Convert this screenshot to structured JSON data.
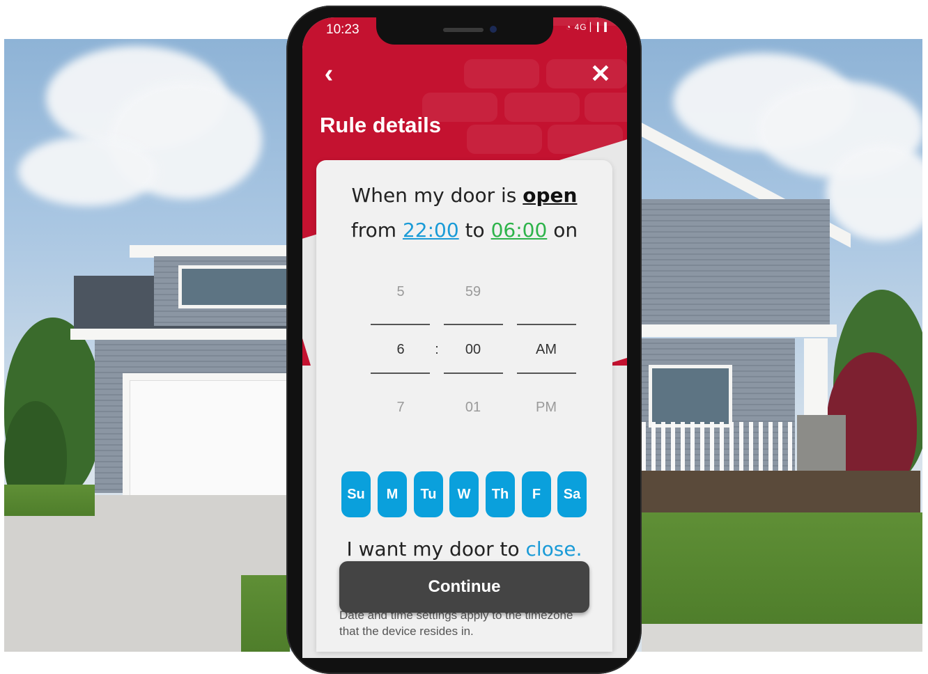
{
  "status_bar": {
    "time": "10:23",
    "icons_label": "4G"
  },
  "header": {
    "back_icon": "chevron-left-icon",
    "close_icon": "close-icon",
    "title": "Rule details"
  },
  "rule": {
    "line1_prefix": "When my door is ",
    "door_state": "open",
    "line2_from": "from ",
    "from_time": "22:00",
    "line2_to": " to ",
    "to_time": "06:00",
    "line2_on": " on"
  },
  "time_picker": {
    "hour": {
      "above": "5",
      "selected": "6",
      "below": "7"
    },
    "separator": ":",
    "minute": {
      "above": "59",
      "selected": "00",
      "below": "01"
    },
    "period": {
      "above": "",
      "selected": "AM",
      "below": "PM"
    }
  },
  "days": [
    "Su",
    "M",
    "Tu",
    "W",
    "Th",
    "F",
    "Sa"
  ],
  "action": {
    "prefix": "I want my door to ",
    "value": "close."
  },
  "continue_label": "Continue",
  "footnote": "Date and time settings apply to the timezone that the device resides in.",
  "colors": {
    "brand_red": "#c41230",
    "day_blue": "#0aa0dc",
    "from_time_blue": "#1a9bd7",
    "to_time_green": "#2db34a",
    "button_dark": "#444444"
  }
}
